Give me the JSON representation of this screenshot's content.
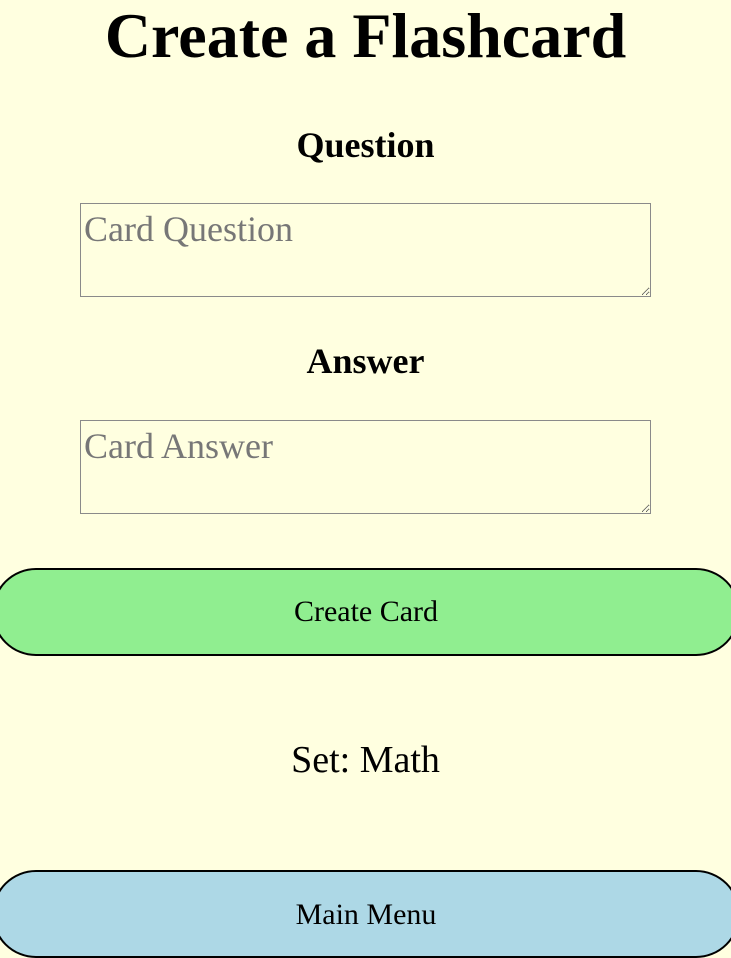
{
  "page": {
    "title": "Create a Flashcard"
  },
  "form": {
    "question_label": "Question",
    "question_placeholder": "Card Question",
    "question_value": "",
    "answer_label": "Answer",
    "answer_placeholder": "Card Answer",
    "answer_value": "",
    "create_button_label": "Create Card"
  },
  "set": {
    "text": "Set: Math"
  },
  "navigation": {
    "main_menu_label": "Main Menu"
  },
  "colors": {
    "background": "#ffffe0",
    "create_button": "#90ee90",
    "main_menu_button": "#add8e6"
  }
}
